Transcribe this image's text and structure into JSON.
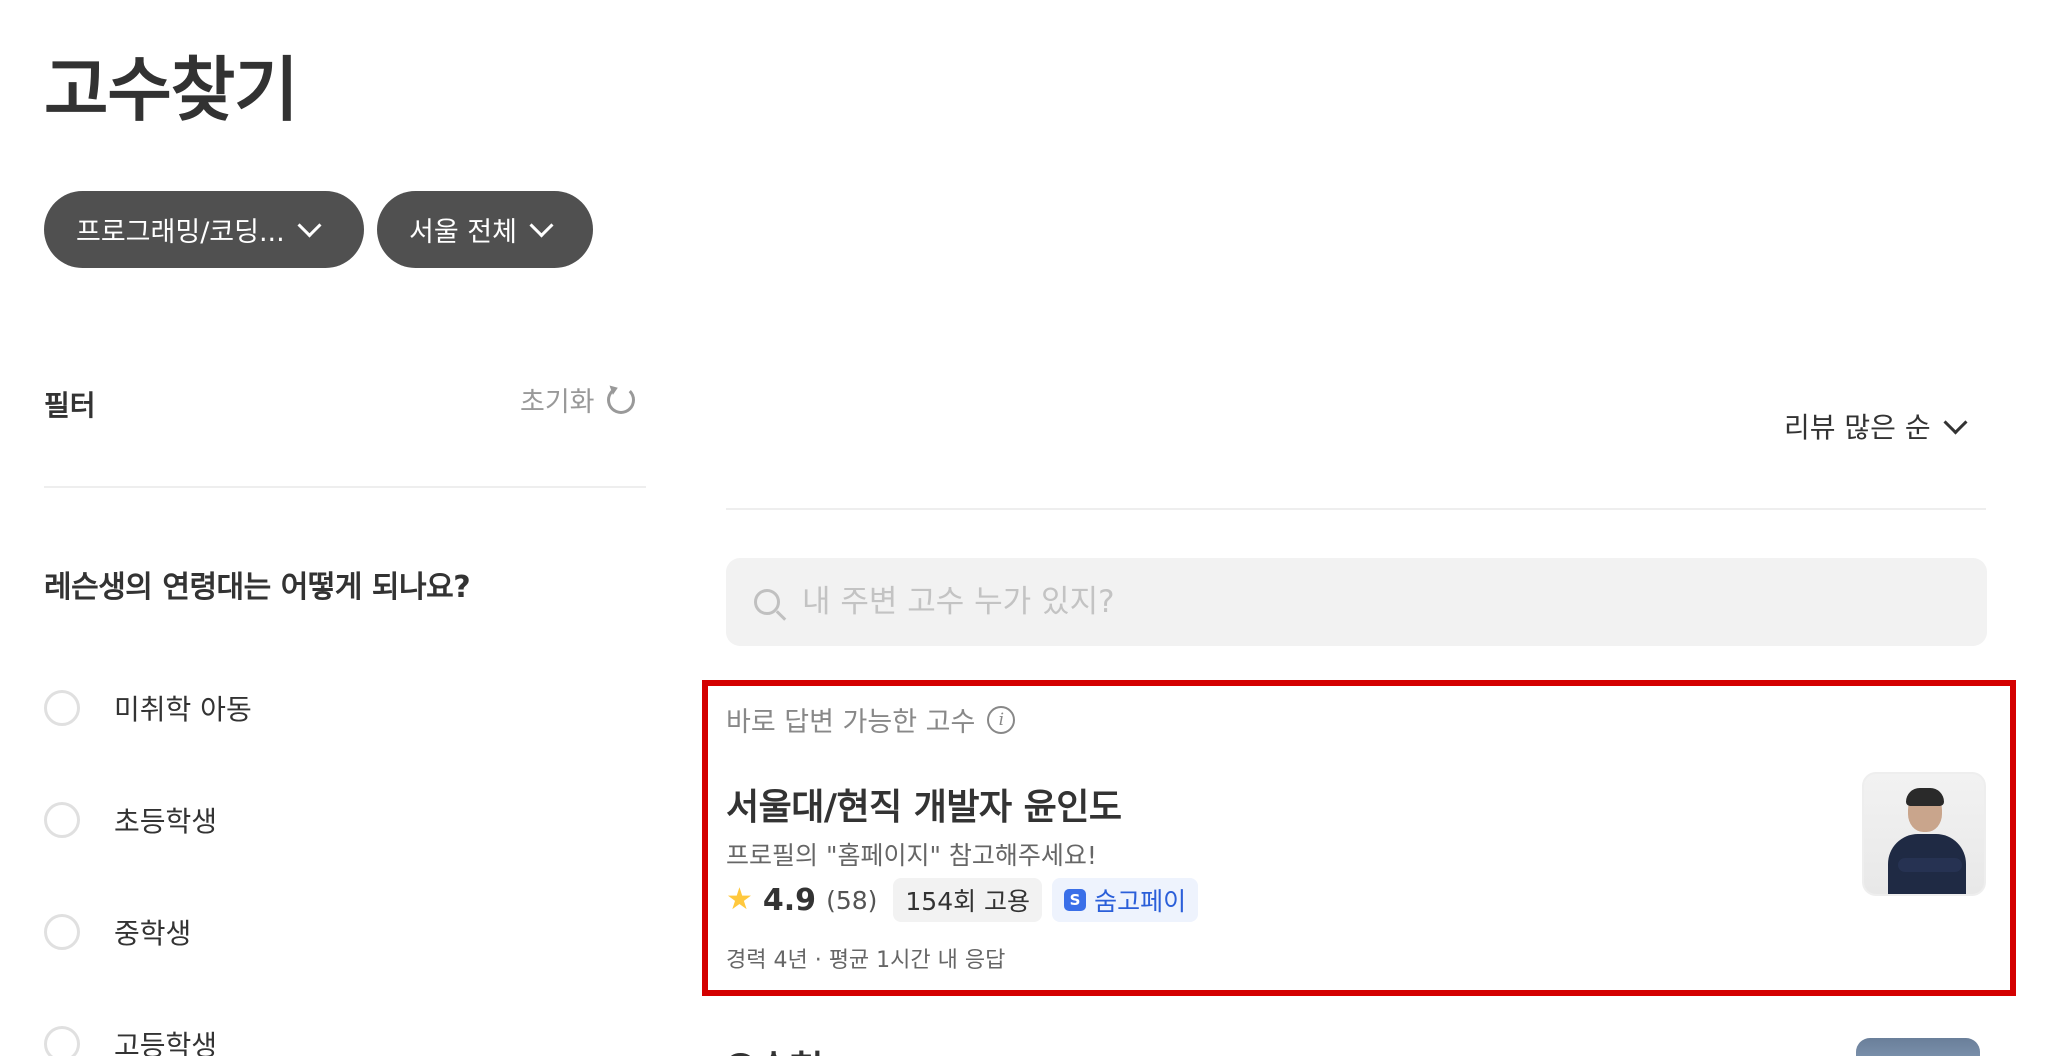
{
  "page": {
    "title": "고수찾기"
  },
  "chips": [
    {
      "label": "프로그래밍/코딩..."
    },
    {
      "label": "서울 전체"
    }
  ],
  "filter": {
    "title": "필터",
    "reset_label": "초기화",
    "question": "레슨생의 연령대는 어떻게 되나요?",
    "options": [
      {
        "label": "미취학 아동"
      },
      {
        "label": "초등학생"
      },
      {
        "label": "중학생"
      },
      {
        "label": "고등학생"
      }
    ]
  },
  "sort": {
    "label": "리뷰 많은 순"
  },
  "search": {
    "placeholder": "내 주변 고수 누가 있지?"
  },
  "featured": {
    "section_label": "바로 답변 가능한 고수",
    "name": "서울대/현직 개발자 윤인도",
    "description": "프로필의 \"홈페이지\" 참고해주세요!",
    "rating": "4.9",
    "review_count": "(58)",
    "hire_count": "154회 고용",
    "pay_badge": "숨고페이",
    "extra": "경력 4년 · 평균 1시간 내 응답"
  },
  "next": {
    "name": "오승현"
  },
  "colors": {
    "chip_bg": "#505050",
    "highlight_border": "#d40000",
    "star": "#ffc83d",
    "pay_blue": "#2b5fd9"
  }
}
